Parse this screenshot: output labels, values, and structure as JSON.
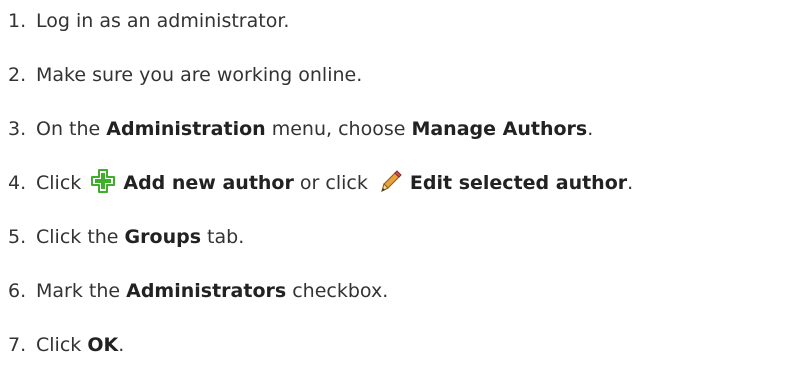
{
  "steps": [
    {
      "num": "1.",
      "parts": [
        {
          "t": "Log in as an administrator."
        }
      ]
    },
    {
      "num": "2.",
      "parts": [
        {
          "t": "Make sure you are working online."
        }
      ]
    },
    {
      "num": "3.",
      "parts": [
        {
          "t": "On the "
        },
        {
          "b": "Administration"
        },
        {
          "t": " menu, choose "
        },
        {
          "b": "Manage Authors"
        },
        {
          "t": "."
        }
      ]
    },
    {
      "num": "4.",
      "parts": [
        {
          "t": "Click "
        },
        {
          "icon": "add-icon"
        },
        {
          "t": " "
        },
        {
          "b": "Add new author"
        },
        {
          "t": " or click "
        },
        {
          "icon": "pencil-icon"
        },
        {
          "t": " "
        },
        {
          "b": "Edit selected author"
        },
        {
          "t": "."
        }
      ]
    },
    {
      "num": "5.",
      "parts": [
        {
          "t": "Click the "
        },
        {
          "b": "Groups"
        },
        {
          "t": " tab."
        }
      ]
    },
    {
      "num": "6.",
      "parts": [
        {
          "t": "Mark the "
        },
        {
          "b": "Administrators"
        },
        {
          "t": " checkbox."
        }
      ]
    },
    {
      "num": "7.",
      "parts": [
        {
          "t": "Click "
        },
        {
          "b": "OK"
        },
        {
          "t": "."
        }
      ]
    }
  ],
  "colors": {
    "text": "#333333",
    "bold_text": "#222222",
    "add_icon_green": "#3fae2a",
    "pencil_orange": "#e8a23c"
  }
}
